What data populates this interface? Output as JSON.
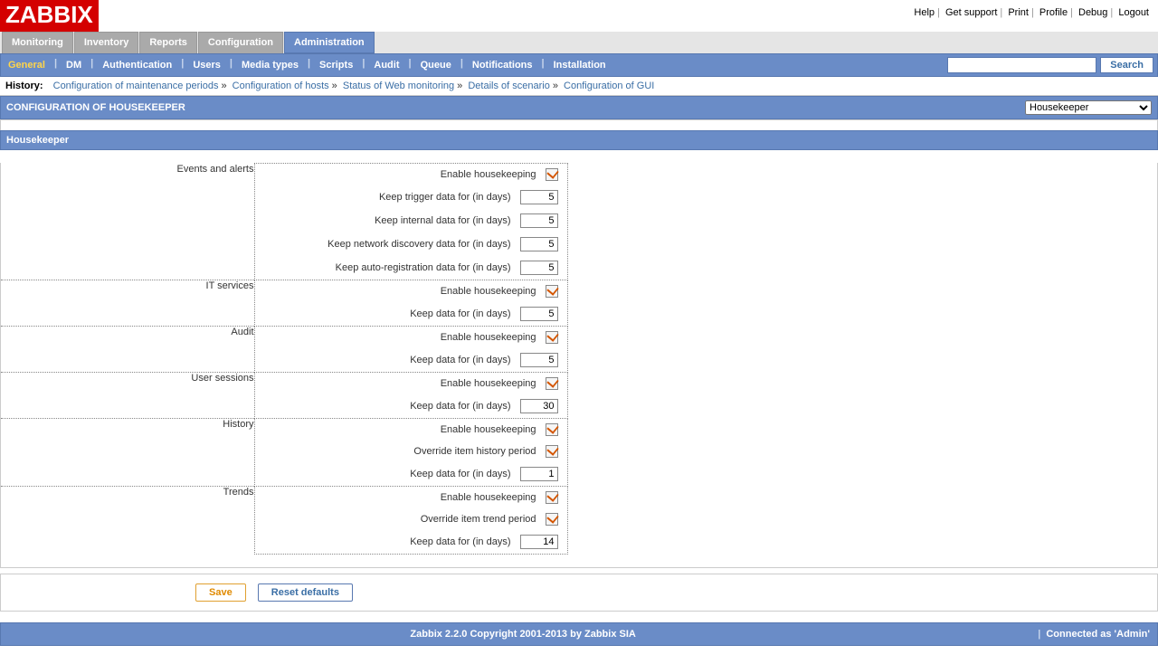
{
  "logo_text": "ZABBIX",
  "top_links": {
    "help": "Help",
    "support": "Get support",
    "print": "Print",
    "profile": "Profile",
    "debug": "Debug",
    "logout": "Logout"
  },
  "tabs1": {
    "monitoring": "Monitoring",
    "inventory": "Inventory",
    "reports": "Reports",
    "configuration": "Configuration",
    "administration": "Administration"
  },
  "tabs2": {
    "general": "General",
    "dm": "DM",
    "authentication": "Authentication",
    "users": "Users",
    "media_types": "Media types",
    "scripts": "Scripts",
    "audit": "Audit",
    "queue": "Queue",
    "notifications": "Notifications",
    "installation": "Installation"
  },
  "search": {
    "placeholder": "",
    "button": "Search"
  },
  "history": {
    "label": "History:",
    "items": [
      "Configuration of maintenance periods",
      "Configuration of hosts",
      "Status of Web monitoring",
      "Details of scenario",
      "Configuration of GUI"
    ]
  },
  "page_title": "CONFIGURATION OF HOUSEKEEPER",
  "dropdown_selected": "Housekeeper",
  "section": "Housekeeper",
  "labels": {
    "enable": "Enable housekeeping",
    "keep_trigger": "Keep trigger data for (in days)",
    "keep_internal": "Keep internal data for (in days)",
    "keep_network": "Keep network discovery data for (in days)",
    "keep_autoreg": "Keep auto-registration data for (in days)",
    "keep_data": "Keep data for (in days)",
    "override_history": "Override item history period",
    "override_trend": "Override item trend period"
  },
  "groups": {
    "events": {
      "title": "Events and alerts",
      "trigger": "5",
      "internal": "5",
      "network": "5",
      "autoreg": "5"
    },
    "it": {
      "title": "IT services",
      "keep": "5"
    },
    "audit": {
      "title": "Audit",
      "keep": "5"
    },
    "sessions": {
      "title": "User sessions",
      "keep": "30"
    },
    "history": {
      "title": "History",
      "keep": "1"
    },
    "trends": {
      "title": "Trends",
      "keep": "14"
    }
  },
  "buttons": {
    "save": "Save",
    "reset": "Reset defaults"
  },
  "footer": {
    "copyright": "Zabbix 2.2.0 Copyright 2001-2013 by Zabbix SIA",
    "connected": "Connected as 'Admin'"
  }
}
